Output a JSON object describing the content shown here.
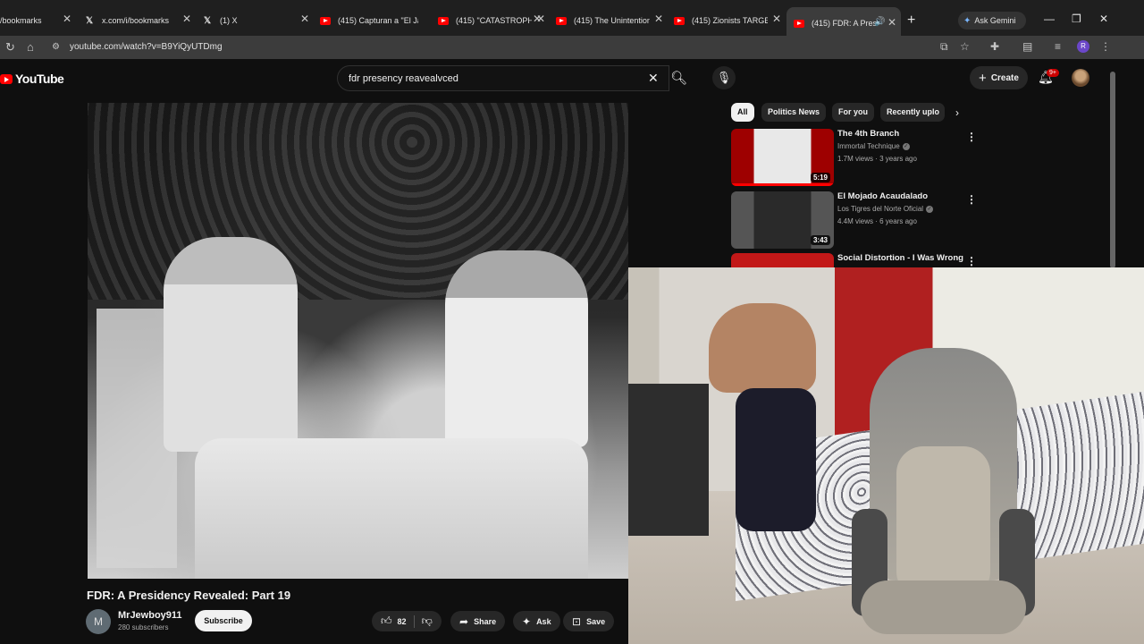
{
  "browser": {
    "tabs": [
      {
        "label": "/bookmarks",
        "icon": "x-logo-icon"
      },
      {
        "label": "x.com/i/bookmarks",
        "icon": "x-logo-icon"
      },
      {
        "label": "(1) X",
        "icon": "x-logo-icon"
      },
      {
        "label": "(415) Capturan a \"El Ja",
        "icon": "youtube-icon"
      },
      {
        "label": "(415) \"CATASTROPHIC",
        "icon": "youtube-icon"
      },
      {
        "label": "(415) The Unintention",
        "icon": "youtube-icon"
      },
      {
        "label": "(415) Zionists TARGET",
        "icon": "youtube-icon"
      },
      {
        "label": "(415) FDR: A Presid",
        "icon": "youtube-icon",
        "active": true
      }
    ],
    "ask_gemini": "Ask Gemini",
    "url": "youtube.com/watch?v=B9YiQyUTDmg",
    "profile_initial": "R"
  },
  "youtube": {
    "logo_text": "YouTube",
    "search_value": "fdr presency reavealvced",
    "create_label": "Create",
    "notification_badge": "9+",
    "video": {
      "title": "FDR: A Presidency Revealed: Part 19",
      "channel_name": "MrJewboy911",
      "channel_initial": "M",
      "subscribers": "280 subscribers",
      "subscribe_label": "Subscribe",
      "likes": "82",
      "share_label": "Share",
      "ask_label": "Ask",
      "save_label": "Save"
    },
    "chips": [
      "All",
      "Politics News",
      "For you",
      "Recently uplo"
    ],
    "recommendations": [
      {
        "title": "The 4th Branch",
        "channel": "Immortal Technique",
        "meta": "1.7M views · 3 years ago",
        "duration": "5:19"
      },
      {
        "title": "El Mojado Acaudalado",
        "channel": "Los Tigres del Norte Oficial",
        "meta": "4.4M views · 6 years ago",
        "duration": "3:43"
      },
      {
        "title": "Social Distortion - I Was Wrong",
        "channel": "",
        "meta": "",
        "duration": ""
      }
    ]
  },
  "colors": {
    "accent": "#ff0000",
    "background": "#0f0f0f",
    "chip_bg": "#272727"
  }
}
